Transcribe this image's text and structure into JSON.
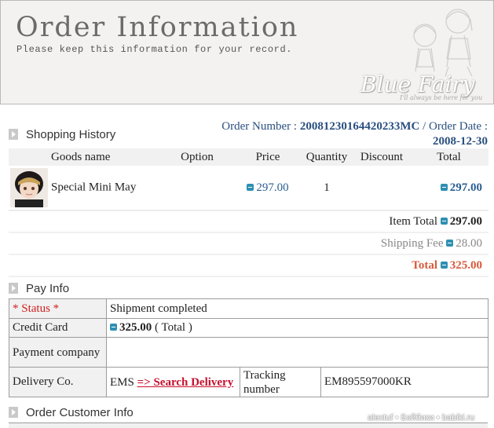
{
  "banner": {
    "title": "Order Information",
    "subtitle": "Please keep this information for your record.",
    "brand": "Blue Fairy",
    "brand_tagline": "I'll always be here for you"
  },
  "shopping_history": {
    "heading": "Shopping History",
    "order_number_label": "Order Number :",
    "order_number": "20081230164420233MC",
    "order_date_label": "/ Order Date :",
    "order_date": "2008-12-30",
    "columns": [
      "Goods name",
      "Option",
      "Price",
      "Quantity",
      "Discount",
      "Total"
    ],
    "items": [
      {
        "name": "Special Mini May",
        "option": "",
        "price": "297.00",
        "quantity": "1",
        "discount": "",
        "total": "297.00"
      }
    ],
    "item_total_label": "Item Total",
    "item_total": "297.00",
    "shipping_fee_label": "Shipping Fee",
    "shipping_fee": "28.00",
    "total_label": "Total",
    "total": "325.00"
  },
  "pay_info": {
    "heading": "Pay Info",
    "status_label": "* Status *",
    "status_value": "Shipment completed",
    "credit_card_label": "Credit Card",
    "credit_card_amount": "325.00",
    "credit_card_note": "( Total )",
    "payment_company_label": "Payment company",
    "payment_company_value": "",
    "delivery_label": "Delivery Co.",
    "delivery_company": "EMS",
    "search_delivery_link": "=> Search Delivery",
    "tracking_label": "Tracking number",
    "tracking_number": "EM895597000KR"
  },
  "order_customer_info": {
    "heading": "Order Customer Info"
  },
  "watermark": "alextuf • Бэйбики • babiki.ru",
  "colors": {
    "accent_blue": "#2a4f80",
    "price_blue": "#2a5f93",
    "total_red": "#d85a3c",
    "required_red": "#d21f1f",
    "link_red": "#c8102e",
    "header_bg": "#f1f1f1"
  }
}
